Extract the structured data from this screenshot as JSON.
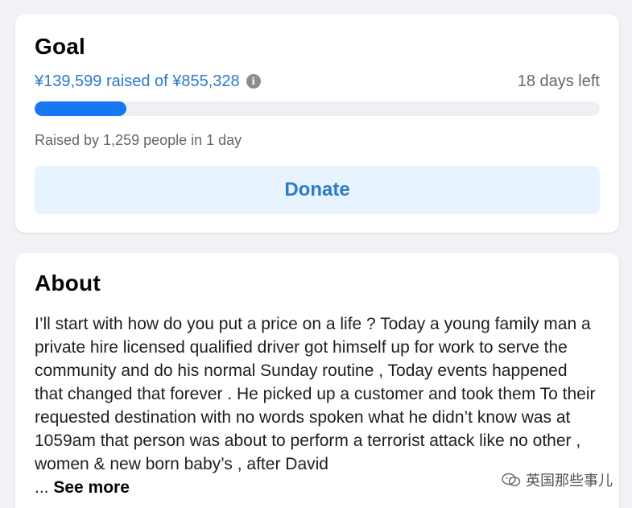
{
  "goal": {
    "title": "Goal",
    "raised_text": "¥139,599 raised of ¥855,328",
    "raised_amount": 139599,
    "goal_amount": 855328,
    "progress_fraction": 0.163,
    "days_left": "18 days left",
    "raised_by": "Raised by 1,259 people in 1 day",
    "donate_label": "Donate",
    "info_icon": "info-icon",
    "colors": {
      "accent": "#1877f2",
      "donate_bg": "#e7f3ff",
      "donate_text": "#2e7bc4"
    }
  },
  "about": {
    "title": "About",
    "body": "I’ll start with how do you put a price on a life ? Today a young family man a private hire licensed qualified driver got himself up for work to serve the community and do his normal Sunday routine , Today events happened that changed that forever . He picked up a customer and took them To their requested destination with no words spoken what he didn’t know was at 1059am that person was about to perform a terrorist attack like no other , women & new born baby’s , after David",
    "ellipsis": "... ",
    "see_more": "See more"
  },
  "watermark": {
    "text": "英国那些事儿",
    "icon": "wechat-logo"
  }
}
